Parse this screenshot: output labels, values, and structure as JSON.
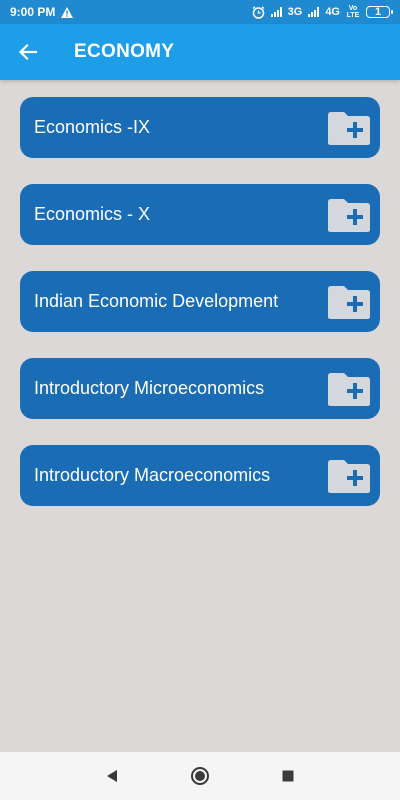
{
  "status_bar": {
    "time": "9:00 PM",
    "network_3g": "3G",
    "network_4g": "4G",
    "volte": "Vo LTE",
    "battery": "1"
  },
  "app_bar": {
    "title": "ECONOMY",
    "color": "#1e9de8"
  },
  "books": [
    {
      "label": "Economics -IX"
    },
    {
      "label": "Economics - X"
    },
    {
      "label": "Indian Economic Development"
    },
    {
      "label": "Introductory Microeconomics"
    },
    {
      "label": "Introductory Macroeconomics"
    }
  ],
  "colors": {
    "item_background": "#1a6cb5",
    "page_background": "#dcd8d8",
    "status_bar": "#1f8ad0"
  },
  "icons": {
    "back": "arrow-left-icon",
    "item": "folder-plus-icon",
    "nav_back": "triangle-back-icon",
    "nav_home": "circle-home-icon",
    "nav_recents": "square-recents-icon"
  }
}
